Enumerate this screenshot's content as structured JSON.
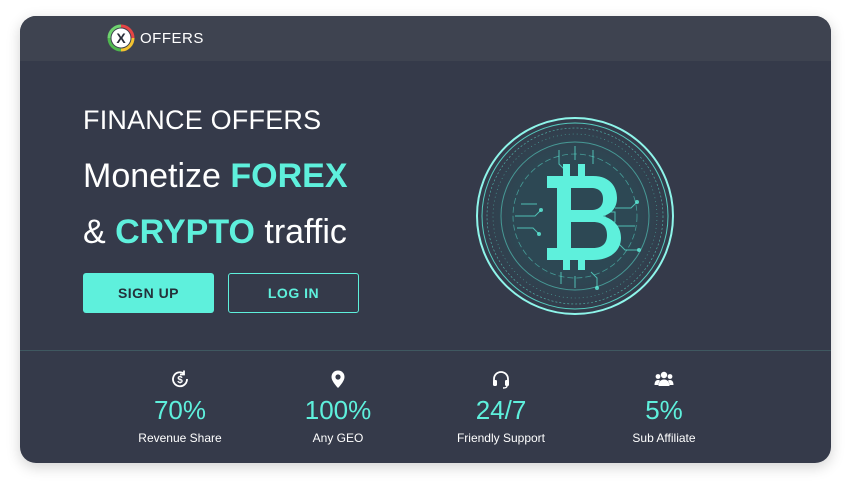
{
  "brand": {
    "logo_mark_letter": "X",
    "logo_text": "OFFERS"
  },
  "hero": {
    "kicker": "FINANCE OFFERS",
    "line2_prefix": "Monetize ",
    "line2_accent": "FOREX",
    "line3_prefix": "& ",
    "line3_accent": "CRYPTO",
    "line3_suffix": " traffic",
    "signup_label": "SIGN UP",
    "login_label": "LOG IN",
    "coin_icon": "bitcoin-icon"
  },
  "stats": [
    {
      "icon": "dollar-cycle-icon",
      "value": "70%",
      "label": "Revenue Share"
    },
    {
      "icon": "location-pin-icon",
      "value": "100%",
      "label": "Any GEO"
    },
    {
      "icon": "headset-icon",
      "value": "24/7",
      "label": "Friendly Support"
    },
    {
      "icon": "users-icon",
      "value": "5%",
      "label": "Sub Affiliate"
    }
  ],
  "colors": {
    "accent": "#5ef0dc",
    "background": "#353a4a",
    "topbar": "#3e4350",
    "text": "#ffffff"
  }
}
